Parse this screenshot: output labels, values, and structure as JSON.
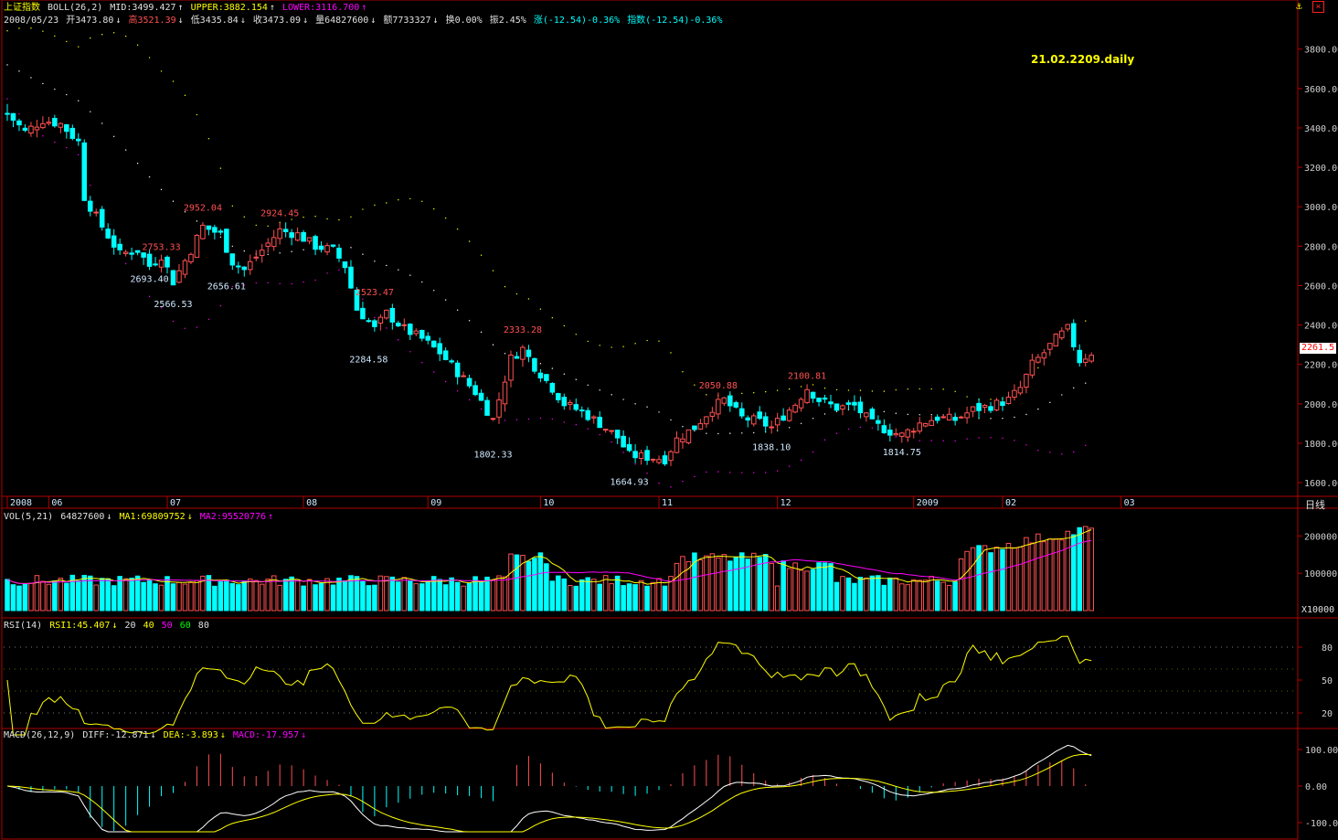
{
  "header": {
    "index_name": "上证指数",
    "indicator": "BOLL(26,2)",
    "mid": "MID:3499.427",
    "upper": "UPPER:3882.154",
    "lower": "LOWER:3116.700",
    "arrow_up": "↑",
    "arrow_down": "↓"
  },
  "quote": {
    "date": "2008/05/23",
    "open": "开3473.80",
    "high": "高3521.39",
    "low": "低3435.84",
    "close": "收3473.09",
    "volume": "量64827600",
    "amount": "额7733327",
    "turnover": "换0.00%",
    "amplitude": "振2.45%",
    "change": "涨(-12.54)-0.36%",
    "index_change": "指数(-12.54)-0.36%"
  },
  "tag_text": "21.02.2209.daily",
  "period_label": "日线",
  "current_price_tag": "2261.5",
  "vol_panel": {
    "label": "VOL(5,21)",
    "value": "64827600",
    "ma1": "MA1:69809752",
    "ma2": "MA2:95520776",
    "unit": "X10000"
  },
  "rsi_panel": {
    "label": "RSI(14)",
    "rsi1": "RSI1:45.407",
    "levels": [
      "20",
      "40",
      "50",
      "60",
      "80"
    ]
  },
  "macd_panel": {
    "label": "MACD(26,12,9)",
    "diff": "DIFF:-12.871",
    "dea": "DEA:-3.893",
    "macd": "MACD:-17.957"
  },
  "colors": {
    "background": "#000000",
    "up": "#ff5050",
    "down": "#00ffff",
    "ma1": "#ffff00",
    "ma2": "#ff00ff",
    "frame": "#b00000",
    "upper_band": "#ffff00",
    "mid_band": "#ffffff",
    "lower_band": "#ff00ff"
  },
  "chart_data": {
    "type": "candlestick",
    "price_axis": {
      "ticks": [
        1600,
        1800,
        2000,
        2200,
        2400,
        2600,
        2800,
        3000,
        3200,
        3400,
        3600,
        3800
      ],
      "tick_labels": [
        "1600.00",
        "1800.00",
        "2000.00",
        "2200.00",
        "2400.00",
        "2600.00",
        "2800.00",
        "3000.00",
        "3200.00",
        "3400.00",
        "3600.00",
        "3800.00"
      ],
      "range": [
        1540,
        3910
      ]
    },
    "time_axis": [
      {
        "label": "2008",
        "index": 0
      },
      {
        "label": "06",
        "index": 7
      },
      {
        "label": "07",
        "index": 27
      },
      {
        "label": "08",
        "index": 50
      },
      {
        "label": "09",
        "index": 71
      },
      {
        "label": "10",
        "index": 90
      },
      {
        "label": "11",
        "index": 110
      },
      {
        "label": "12",
        "index": 130
      },
      {
        "label": "2009",
        "index": 153
      },
      {
        "label": "02",
        "index": 168
      },
      {
        "label": "03",
        "index": 188
      }
    ],
    "annotations": [
      {
        "text": "2952.04",
        "index": 33,
        "value": 2952,
        "type": "high"
      },
      {
        "text": "2753.33",
        "index": 26,
        "value": 2753,
        "type": "high"
      },
      {
        "text": "2693.40",
        "index": 24,
        "value": 2693,
        "type": "low"
      },
      {
        "text": "2566.53",
        "index": 28,
        "value": 2566,
        "type": "low"
      },
      {
        "text": "2656.61",
        "index": 37,
        "value": 2656,
        "type": "low"
      },
      {
        "text": "2924.45",
        "index": 46,
        "value": 2924,
        "type": "high"
      },
      {
        "text": "2523.47",
        "index": 62,
        "value": 2523,
        "type": "high"
      },
      {
        "text": "2284.58",
        "index": 61,
        "value": 2284,
        "type": "low"
      },
      {
        "text": "2333.28",
        "index": 87,
        "value": 2333,
        "type": "high"
      },
      {
        "text": "1802.33",
        "index": 82,
        "value": 1802,
        "type": "low"
      },
      {
        "text": "1664.93",
        "index": 105,
        "value": 1664,
        "type": "low"
      },
      {
        "text": "2050.88",
        "index": 120,
        "value": 2050,
        "type": "high"
      },
      {
        "text": "1838.10",
        "index": 129,
        "value": 1838,
        "type": "low"
      },
      {
        "text": "2100.81",
        "index": 135,
        "value": 2100,
        "type": "high"
      },
      {
        "text": "1814.75",
        "index": 151,
        "value": 1814,
        "type": "low"
      }
    ],
    "vol_axis": {
      "ticks": [
        100000,
        200000
      ],
      "tick_labels": [
        "100000",
        "200000"
      ],
      "range": [
        0,
        240000
      ]
    },
    "rsi_axis": {
      "ticks": [
        20,
        50,
        80
      ],
      "tick_labels": [
        "20",
        "50",
        "80"
      ],
      "range": [
        10,
        95
      ]
    },
    "macd_axis": {
      "ticks": [
        -100,
        0,
        100
      ],
      "tick_labels": [
        "-100.00",
        "0.00",
        "100.00"
      ],
      "range": [
        -130,
        130
      ]
    }
  }
}
